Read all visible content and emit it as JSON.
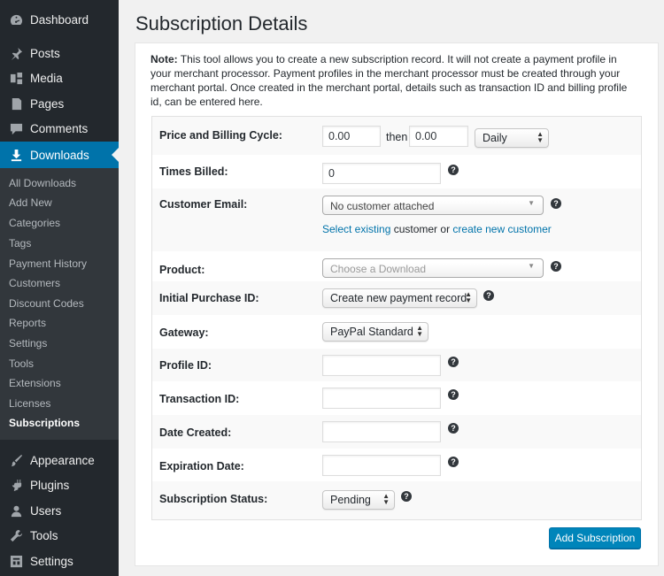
{
  "sidebar": {
    "top_items": [
      {
        "label": "Dashboard",
        "icon": "dashboard-icon"
      },
      {
        "label": "Posts",
        "icon": "pin-icon"
      },
      {
        "label": "Media",
        "icon": "media-icon"
      },
      {
        "label": "Pages",
        "icon": "pages-icon"
      },
      {
        "label": "Comments",
        "icon": "comment-icon"
      },
      {
        "label": "Downloads",
        "icon": "download-icon"
      }
    ],
    "submenu": [
      "All Downloads",
      "Add New",
      "Categories",
      "Tags",
      "Payment History",
      "Customers",
      "Discount Codes",
      "Reports",
      "Settings",
      "Tools",
      "Extensions",
      "Licenses",
      "Subscriptions"
    ],
    "bottom_items": [
      {
        "label": "Appearance",
        "icon": "brush-icon"
      },
      {
        "label": "Plugins",
        "icon": "plug-icon"
      },
      {
        "label": "Users",
        "icon": "user-icon"
      },
      {
        "label": "Tools",
        "icon": "wrench-icon"
      },
      {
        "label": "Settings",
        "icon": "settings-icon"
      }
    ],
    "active_item": "Downloads",
    "current_subitem": "Subscriptions"
  },
  "page": {
    "title": "Subscription Details",
    "note_label": "Note:",
    "note_text": " This tool allows you to create a new subscription record. It will not create a payment profile in your merchant processor. Payment profiles in the merchant processor must be created through your merchant portal. Once created in the merchant portal, details such as transaction ID and billing profile id, can be entered here."
  },
  "form": {
    "price_label": "Price and Billing Cycle:",
    "initial_amount": "0.00",
    "then_text": "then",
    "recurring_amount": "0.00",
    "period": "Daily",
    "times_billed_label": "Times Billed:",
    "times_billed": "0",
    "customer_email_label": "Customer Email:",
    "customer_select": "No customer attached",
    "select_existing_link": "Select existing",
    "customer_or_text": " customer or ",
    "create_new_link": "create new customer",
    "product_label": "Product:",
    "product_placeholder": "Choose a Download",
    "initial_purchase_label": "Initial Purchase ID:",
    "initial_purchase_select": "Create new payment record",
    "gateway_label": "Gateway:",
    "gateway_select": "PayPal Standard",
    "profile_id_label": "Profile ID:",
    "profile_id": "",
    "transaction_id_label": "Transaction ID:",
    "transaction_id": "",
    "date_created_label": "Date Created:",
    "date_created": "",
    "expiration_label": "Expiration Date:",
    "expiration": "",
    "status_label": "Subscription Status:",
    "status_select": "Pending",
    "help_glyph": "?",
    "submit_label": "Add Subscription"
  },
  "colors": {
    "sidebar_bg": "#23282d",
    "submenu_bg": "#32373c",
    "accent": "#0073aa",
    "button_bg": "#0085ba"
  }
}
